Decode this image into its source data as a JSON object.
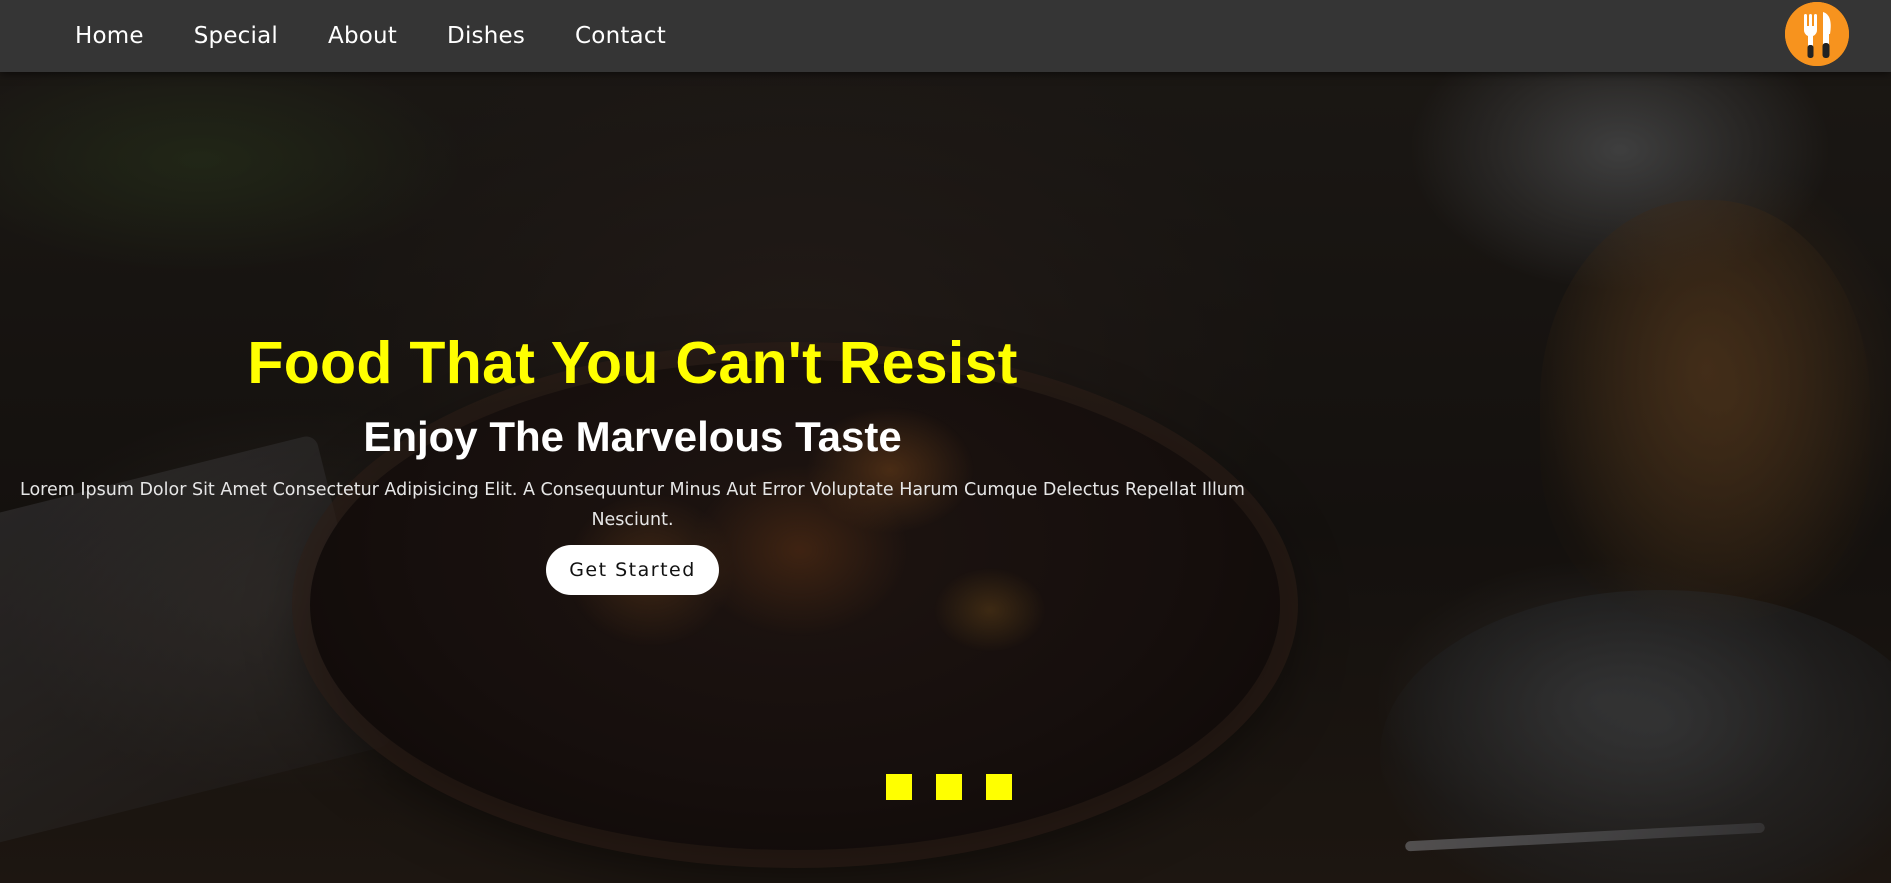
{
  "nav": {
    "links": [
      {
        "label": "Home"
      },
      {
        "label": "Special"
      },
      {
        "label": "About"
      },
      {
        "label": "Dishes"
      },
      {
        "label": "Contact"
      }
    ],
    "logo_icon": "fork-knife-icon",
    "logo_color": "#f7931e"
  },
  "hero": {
    "title": "Food That You Can't Resist",
    "subtitle": "Enjoy The Marvelous Taste",
    "description": "Lorem Ipsum Dolor Sit Amet Consectetur Adipisicing Elit. A Consequuntur Minus Aut Error Voluptate Harum Cumque Delectus Repellat Illum Nesciunt.",
    "cta_label": "Get Started"
  },
  "slider": {
    "dot_count": 3
  },
  "colors": {
    "accent": "#ffff00",
    "navbar": "#353535",
    "button_bg": "#ffffff"
  }
}
